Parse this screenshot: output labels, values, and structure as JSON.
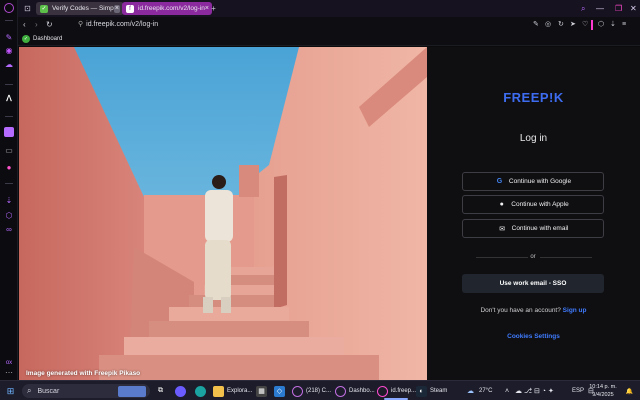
{
  "browser": {
    "tabs": [
      {
        "label": "Verify Codes — Simp",
        "favicon": "green-check-icon"
      },
      {
        "label": "id.freepik.com/v2/log-in",
        "favicon": "freepik-icon"
      }
    ],
    "url": "id.freepik.com/v2/log-in",
    "bookmark": "Dashboard"
  },
  "photo": {
    "caption": "Image generated with Freepik Pikaso"
  },
  "login": {
    "logo": "FREEP!K",
    "title": "Log in",
    "google": "Continue with Google",
    "apple": "Continue with Apple",
    "email": "Continue with email",
    "or": "or",
    "sso": "Use work email - SSO",
    "no_account": "Don't you have an account?",
    "signup": "Sign up",
    "cookies": "Cookies Settings"
  },
  "taskbar": {
    "search": "Buscar",
    "items": [
      {
        "label": "Explora..."
      },
      {
        "label": "(218) C..."
      },
      {
        "label": "Dashbo..."
      },
      {
        "label": "id.freep..."
      },
      {
        "label": "Steam"
      }
    ],
    "weather": "27°C",
    "lang": "ESP",
    "time": "10:14 p. m.",
    "date": "9/4/2025",
    "notif": "3"
  },
  "colors": {
    "brand_blue": "#3d6cf0",
    "link_blue": "#3f7bff",
    "tab_active": "#8b2a9e"
  }
}
